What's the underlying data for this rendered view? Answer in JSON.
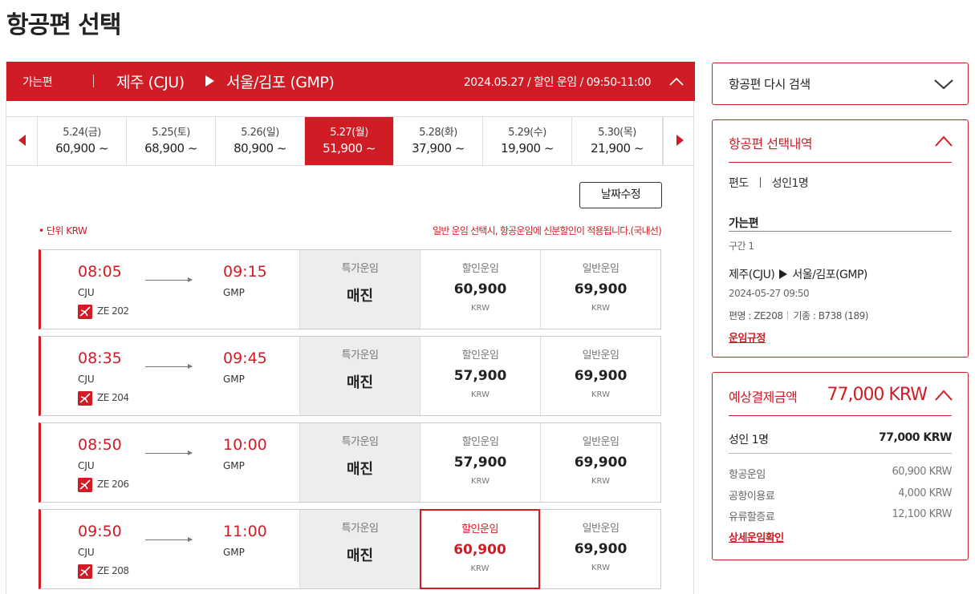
{
  "page": {
    "title": "항공편 선택"
  },
  "route": {
    "direction": "가는편",
    "from": "제주 (CJU)",
    "to": "서울/김포 (GMP)",
    "info": "2024.05.27 / 할인 운임 / 09:50-11:00"
  },
  "dates": [
    {
      "date": "5.24(금)",
      "price": "60,900 ~"
    },
    {
      "date": "5.25(토)",
      "price": "68,900 ~"
    },
    {
      "date": "5.26(일)",
      "price": "80,900 ~"
    },
    {
      "date": "5.27(월)",
      "price": "51,900 ~",
      "selected": true
    },
    {
      "date": "5.28(화)",
      "price": "37,900 ~"
    },
    {
      "date": "5.29(수)",
      "price": "19,900 ~"
    },
    {
      "date": "5.30(목)",
      "price": "21,900 ~"
    }
  ],
  "edit_date_label": "날짜수정",
  "unit_note": "• 단위 KRW",
  "fare_note": "일반 운임 선택시, 항공운임에 신분할인이 적용됩니다.(국내선)",
  "fare_labels": {
    "special": "특가운임",
    "discount": "할인운임",
    "normal": "일반운임",
    "currency": "KRW",
    "sold_out": "매진"
  },
  "flights": [
    {
      "dep_time": "08:05",
      "dep_code": "CJU",
      "arr_time": "09:15",
      "arr_code": "GMP",
      "flight_no": "ZE 202",
      "special": "매진",
      "discount": "60,900",
      "normal": "69,900"
    },
    {
      "dep_time": "08:35",
      "dep_code": "CJU",
      "arr_time": "09:45",
      "arr_code": "GMP",
      "flight_no": "ZE 204",
      "special": "매진",
      "discount": "57,900",
      "normal": "69,900"
    },
    {
      "dep_time": "08:50",
      "dep_code": "CJU",
      "arr_time": "10:00",
      "arr_code": "GMP",
      "flight_no": "ZE 206",
      "special": "매진",
      "discount": "57,900",
      "normal": "69,900"
    },
    {
      "dep_time": "09:50",
      "dep_code": "CJU",
      "arr_time": "11:00",
      "arr_code": "GMP",
      "flight_no": "ZE 208",
      "special": "매진",
      "discount": "60,900",
      "normal": "69,900",
      "selected_fare": "discount"
    }
  ],
  "research": {
    "label": "항공편 다시 검색"
  },
  "selection": {
    "title": "항공편 선택내역",
    "trip_type": "편도",
    "passengers": "성인1명",
    "leg_label": "가는편",
    "segment": "구간 1",
    "route_from": "제주(CJU)",
    "route_to": "서울/김포(GMP)",
    "datetime": "2024-05-27 09:50",
    "flight_no": "편명 : ZE208",
    "aircraft": "기종 : B738 (189)",
    "rules_link": "운임규정"
  },
  "payment": {
    "title": "예상결제금액",
    "total": "77,000 KRW",
    "passenger_label": "성인 1명",
    "passenger_total": "77,000 KRW",
    "items": [
      {
        "label": "항공운임",
        "value": "60,900 KRW"
      },
      {
        "label": "공항이용료",
        "value": "4,000 KRW"
      },
      {
        "label": "유류할증료",
        "value": "12,100 KRW"
      }
    ],
    "detail_link": "상세운임확인"
  },
  "colors": {
    "accent": "#d01c24",
    "sold_bg": "#ededed"
  }
}
